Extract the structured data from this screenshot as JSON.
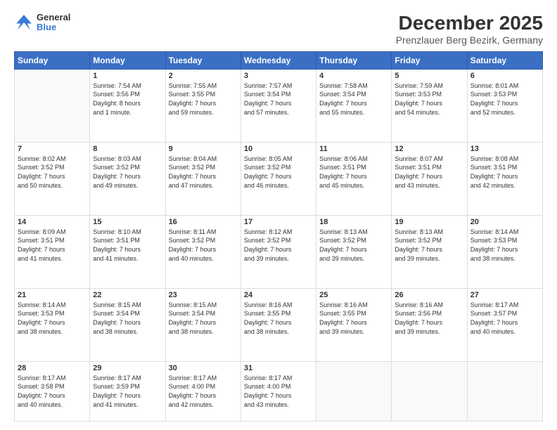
{
  "header": {
    "logo_line1": "General",
    "logo_line2": "Blue",
    "title": "December 2025",
    "subtitle": "Prenzlauer Berg Bezirk, Germany"
  },
  "days_of_week": [
    "Sunday",
    "Monday",
    "Tuesday",
    "Wednesday",
    "Thursday",
    "Friday",
    "Saturday"
  ],
  "weeks": [
    [
      {
        "day": "",
        "info": ""
      },
      {
        "day": "1",
        "info": "Sunrise: 7:54 AM\nSunset: 3:56 PM\nDaylight: 8 hours\nand 1 minute."
      },
      {
        "day": "2",
        "info": "Sunrise: 7:55 AM\nSunset: 3:55 PM\nDaylight: 7 hours\nand 59 minutes."
      },
      {
        "day": "3",
        "info": "Sunrise: 7:57 AM\nSunset: 3:54 PM\nDaylight: 7 hours\nand 57 minutes."
      },
      {
        "day": "4",
        "info": "Sunrise: 7:58 AM\nSunset: 3:54 PM\nDaylight: 7 hours\nand 55 minutes."
      },
      {
        "day": "5",
        "info": "Sunrise: 7:59 AM\nSunset: 3:53 PM\nDaylight: 7 hours\nand 54 minutes."
      },
      {
        "day": "6",
        "info": "Sunrise: 8:01 AM\nSunset: 3:53 PM\nDaylight: 7 hours\nand 52 minutes."
      }
    ],
    [
      {
        "day": "7",
        "info": "Sunrise: 8:02 AM\nSunset: 3:52 PM\nDaylight: 7 hours\nand 50 minutes."
      },
      {
        "day": "8",
        "info": "Sunrise: 8:03 AM\nSunset: 3:52 PM\nDaylight: 7 hours\nand 49 minutes."
      },
      {
        "day": "9",
        "info": "Sunrise: 8:04 AM\nSunset: 3:52 PM\nDaylight: 7 hours\nand 47 minutes."
      },
      {
        "day": "10",
        "info": "Sunrise: 8:05 AM\nSunset: 3:52 PM\nDaylight: 7 hours\nand 46 minutes."
      },
      {
        "day": "11",
        "info": "Sunrise: 8:06 AM\nSunset: 3:51 PM\nDaylight: 7 hours\nand 45 minutes."
      },
      {
        "day": "12",
        "info": "Sunrise: 8:07 AM\nSunset: 3:51 PM\nDaylight: 7 hours\nand 43 minutes."
      },
      {
        "day": "13",
        "info": "Sunrise: 8:08 AM\nSunset: 3:51 PM\nDaylight: 7 hours\nand 42 minutes."
      }
    ],
    [
      {
        "day": "14",
        "info": "Sunrise: 8:09 AM\nSunset: 3:51 PM\nDaylight: 7 hours\nand 41 minutes."
      },
      {
        "day": "15",
        "info": "Sunrise: 8:10 AM\nSunset: 3:51 PM\nDaylight: 7 hours\nand 41 minutes."
      },
      {
        "day": "16",
        "info": "Sunrise: 8:11 AM\nSunset: 3:52 PM\nDaylight: 7 hours\nand 40 minutes."
      },
      {
        "day": "17",
        "info": "Sunrise: 8:12 AM\nSunset: 3:52 PM\nDaylight: 7 hours\nand 39 minutes."
      },
      {
        "day": "18",
        "info": "Sunrise: 8:13 AM\nSunset: 3:52 PM\nDaylight: 7 hours\nand 39 minutes."
      },
      {
        "day": "19",
        "info": "Sunrise: 8:13 AM\nSunset: 3:52 PM\nDaylight: 7 hours\nand 39 minutes."
      },
      {
        "day": "20",
        "info": "Sunrise: 8:14 AM\nSunset: 3:53 PM\nDaylight: 7 hours\nand 38 minutes."
      }
    ],
    [
      {
        "day": "21",
        "info": "Sunrise: 8:14 AM\nSunset: 3:53 PM\nDaylight: 7 hours\nand 38 minutes."
      },
      {
        "day": "22",
        "info": "Sunrise: 8:15 AM\nSunset: 3:54 PM\nDaylight: 7 hours\nand 38 minutes."
      },
      {
        "day": "23",
        "info": "Sunrise: 8:15 AM\nSunset: 3:54 PM\nDaylight: 7 hours\nand 38 minutes."
      },
      {
        "day": "24",
        "info": "Sunrise: 8:16 AM\nSunset: 3:55 PM\nDaylight: 7 hours\nand 38 minutes."
      },
      {
        "day": "25",
        "info": "Sunrise: 8:16 AM\nSunset: 3:55 PM\nDaylight: 7 hours\nand 39 minutes."
      },
      {
        "day": "26",
        "info": "Sunrise: 8:16 AM\nSunset: 3:56 PM\nDaylight: 7 hours\nand 39 minutes."
      },
      {
        "day": "27",
        "info": "Sunrise: 8:17 AM\nSunset: 3:57 PM\nDaylight: 7 hours\nand 40 minutes."
      }
    ],
    [
      {
        "day": "28",
        "info": "Sunrise: 8:17 AM\nSunset: 3:58 PM\nDaylight: 7 hours\nand 40 minutes."
      },
      {
        "day": "29",
        "info": "Sunrise: 8:17 AM\nSunset: 3:59 PM\nDaylight: 7 hours\nand 41 minutes."
      },
      {
        "day": "30",
        "info": "Sunrise: 8:17 AM\nSunset: 4:00 PM\nDaylight: 7 hours\nand 42 minutes."
      },
      {
        "day": "31",
        "info": "Sunrise: 8:17 AM\nSunset: 4:00 PM\nDaylight: 7 hours\nand 43 minutes."
      },
      {
        "day": "",
        "info": ""
      },
      {
        "day": "",
        "info": ""
      },
      {
        "day": "",
        "info": ""
      }
    ]
  ]
}
